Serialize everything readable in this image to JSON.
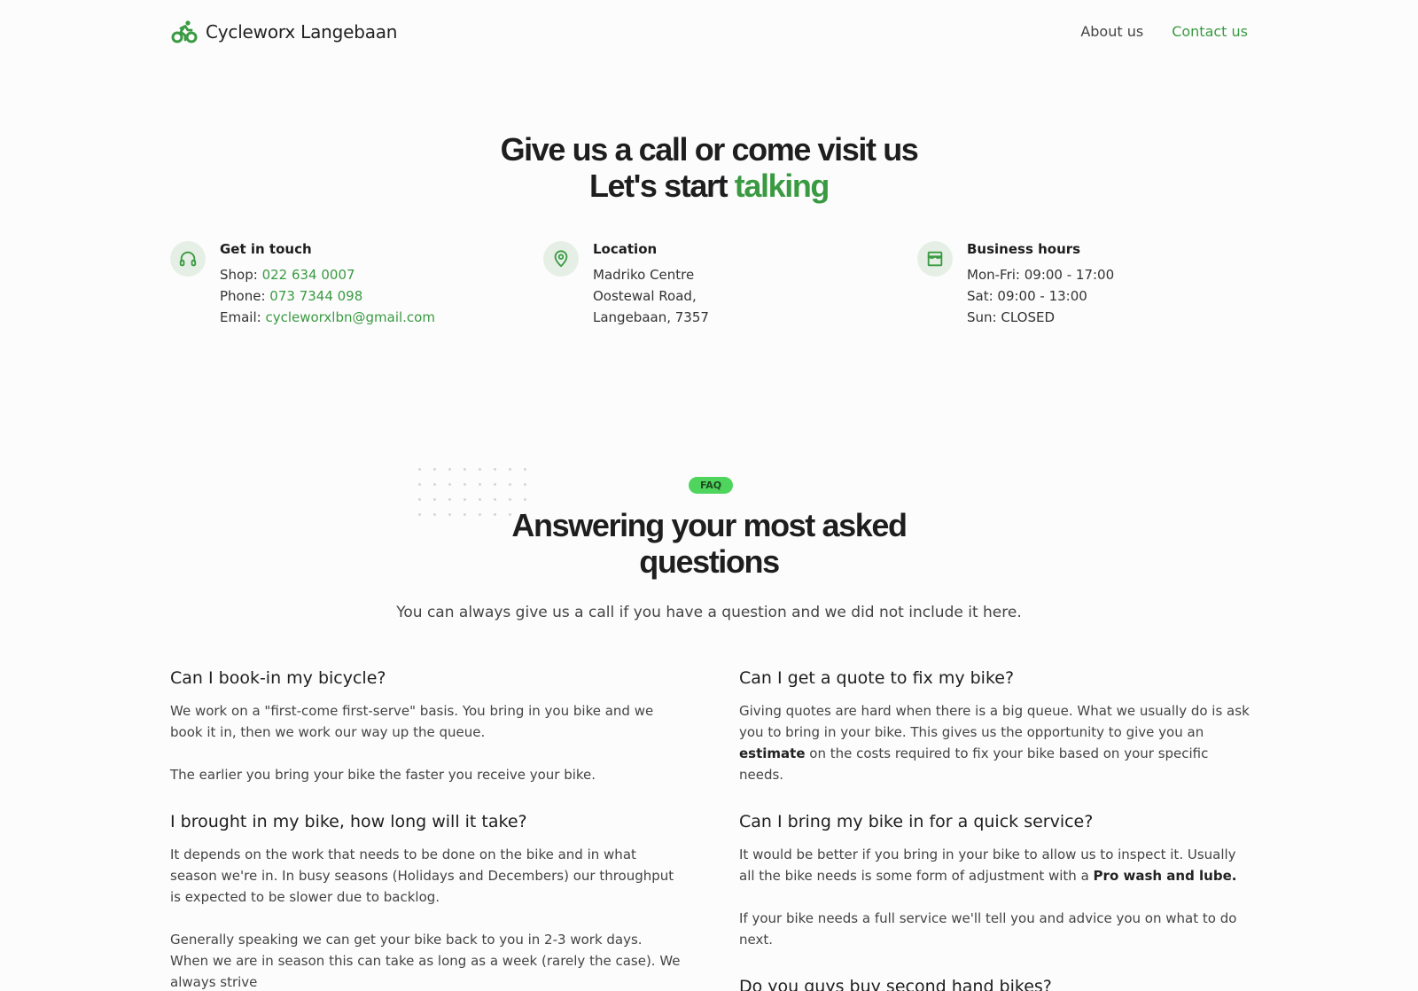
{
  "header": {
    "brand": "Cycleworx Langebaan",
    "brand_icon": "bicycle-rider-icon",
    "nav": {
      "about": "About us",
      "contact": "Contact us"
    }
  },
  "hero": {
    "line1": "Give us a call or come visit us",
    "line2_prefix": "Let's start ",
    "line2_accent": "talking"
  },
  "contact": {
    "get_in_touch": {
      "icon": "headphones-icon",
      "title": "Get in touch",
      "shop_label": "Shop: ",
      "shop": "022 634 0007",
      "phone_label": "Phone: ",
      "phone": "073 7344 098",
      "email_label": "Email: ",
      "email": "cycleworxlbn@gmail.com"
    },
    "location": {
      "icon": "map-pin-icon",
      "title": "Location",
      "line1": "Madriko Centre",
      "line2": "Oostewal Road,",
      "line3": "Langebaan, 7357"
    },
    "hours": {
      "icon": "storefront-icon",
      "title": "Business hours",
      "line1": "Mon-Fri: 09:00 - 17:00",
      "line2": "Sat: 09:00 - 13:00",
      "line3": "Sun: CLOSED"
    }
  },
  "faq": {
    "badge": "FAQ",
    "title_line1": "Answering your most asked",
    "title_line2": "questions",
    "subtitle": "You can always give us a call if you have a question and we did not include it here.",
    "q1": {
      "question": "Can I book-in my bicycle?",
      "p1": "We work on a \"first-come first-serve\" basis. You bring in you bike and we book it in, then we work our way up the queue.",
      "p2": "The earlier you bring your bike the faster you receive your bike."
    },
    "q2": {
      "question": "I brought in my bike, how long will it take?",
      "p1": "It depends on the work that needs to be done on the bike and in what season we're in. In busy seasons (Holidays and Decembers) our throughput is expected to be slower due to backlog.",
      "p2": "Generally speaking we can get your bike back to you in 2-3 work days. When we are in season this can take as long as a week (rarely the case). We always strive"
    },
    "q3": {
      "question": "Can I get a quote to fix my bike?",
      "p1_a": "Giving quotes are hard when there is a big queue. What we usually do is ask you to bring in your bike. This gives us the opportunity to give you an ",
      "p1_bold": "estimate",
      "p1_b": " on the costs required to fix your bike based on your specific needs."
    },
    "q4": {
      "question": "Can I bring my bike in for a quick service?",
      "p1_a": "It would be better if you bring in your bike to allow us to inspect it. Usually all the bike needs is some form of adjustment with a ",
      "p1_bold": "Pro wash and lube.",
      "p2": "If your bike needs a full service we'll tell you and advice you on what to do next."
    },
    "q5": {
      "question": "Do you guys buy second hand bikes?"
    }
  },
  "colors": {
    "accent": "#3a9a42",
    "badge": "#4fd45e",
    "icon_bg": "#e6efe6"
  }
}
